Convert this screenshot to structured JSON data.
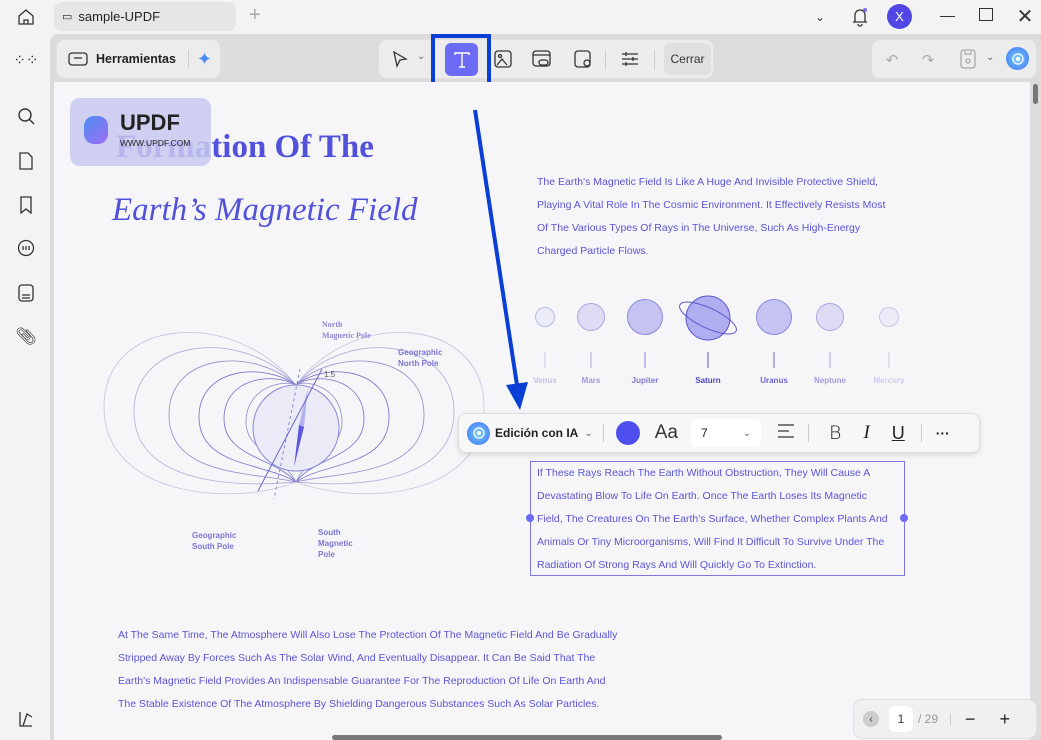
{
  "titlebar": {
    "tab_title": "sample-UPDF",
    "new_tab": "+",
    "avatar_letter": "X"
  },
  "toolbar": {
    "tools_label": "Herramientas",
    "close_label": "Cerrar"
  },
  "document": {
    "logo": {
      "brand": "UPDF",
      "url": "WWW.UPDF.COM"
    },
    "title_line1": "Formation Of The",
    "title_line2": "Earth’s Magnetic Field",
    "intro": [
      "The Earth's Magnetic Field Is Like A Huge And Invisible Protective Shield,",
      "Playing A Vital Role In The Cosmic Environment. It Effectively Resists Most",
      "Of The Various Types Of Rays in The Universe, Such As High-Energy",
      "Charged Particle Flows."
    ],
    "planets": [
      "Venus",
      "Mars",
      "Jupiter",
      "Saturn",
      "Uranus",
      "Neptune",
      "Mercury"
    ],
    "diagram": {
      "north_magnetic": [
        "North",
        "Magnetic Pole"
      ],
      "geo_north": [
        "Geographic",
        "North Pole"
      ],
      "angle": "1.5",
      "geo_south": [
        "Geographic",
        "South Pole"
      ],
      "south_magnetic": [
        "South",
        "Magnetic",
        "Pole"
      ]
    },
    "selected_paragraph": [
      "If These Rays Reach The Earth Without Obstruction, They Will Cause A",
      "Devastating Blow To Life On Earth. Once The Earth Loses Its Magnetic",
      "Field, The Creatures On The Earth's Surface, Whether Complex Plants And",
      "Animals Or Tiny Microorganisms, Will Find It Difficult To Survive Under The",
      "Radiation Of Strong Rays And Will Quickly Go To Extinction."
    ],
    "bottom_paragraph": [
      "At The Same Time, The Atmosphere Will Also Lose The Protection Of The Magnetic Field And Be Gradually",
      "Stripped Away By Forces Such As The Solar Wind, And Eventually Disappear. It Can Be Said That The",
      "Earth's Magnetic Field Provides An Indispensable Guarantee For The Reproduction Of Life On Earth And",
      "The Stable Existence Of The Atmosphere By Shielding Dangerous Substances Such As Solar Particles."
    ]
  },
  "text_edit_bar": {
    "ai_label": "Edición con IA",
    "font_icon": "Aa",
    "font_size": "7",
    "text_color": "#4f4ff0",
    "bold": "B",
    "italic": "I",
    "underline": "U",
    "more": "···"
  },
  "pagination": {
    "current": "1",
    "total": "/ 29"
  },
  "colors": {
    "accent": "#6b6bf5",
    "highlight": "#0a3fd6",
    "text": "#5b55d6"
  }
}
